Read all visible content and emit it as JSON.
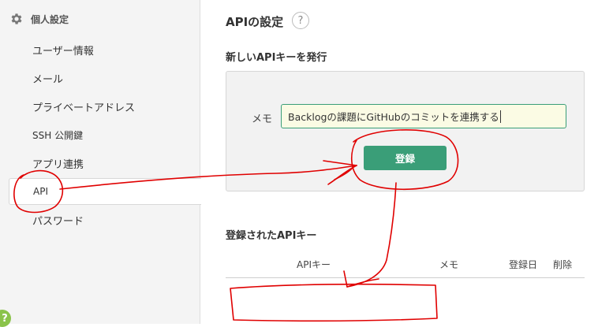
{
  "sidebar": {
    "header": "個人設定",
    "items": [
      {
        "label": "ユーザー情報"
      },
      {
        "label": "メール"
      },
      {
        "label": "プライベートアドレス"
      },
      {
        "label": "SSH 公開鍵"
      },
      {
        "label": "アプリ連携"
      },
      {
        "label": "API",
        "active": true
      },
      {
        "label": "パスワード"
      }
    ],
    "help_badge": "?"
  },
  "main": {
    "title": "APIの設定",
    "help_icon": "?",
    "issue_section": {
      "title": "新しいAPIキーを発行",
      "memo_label": "メモ",
      "memo_value": "Backlogの課題にGitHubのコミットを連携する",
      "register_button": "登録"
    },
    "registered_section": {
      "title": "登録されたAPIキー",
      "columns": [
        "APIキー",
        "メモ",
        "登録日",
        "削除"
      ]
    }
  },
  "colors": {
    "accent": "#3a9e78",
    "input_bg": "#fbfbe4",
    "sidebar_bg": "#f4f4f4",
    "annotation": "#e00000"
  },
  "icons": {
    "settings": "gear-icon",
    "help": "question-icon"
  }
}
